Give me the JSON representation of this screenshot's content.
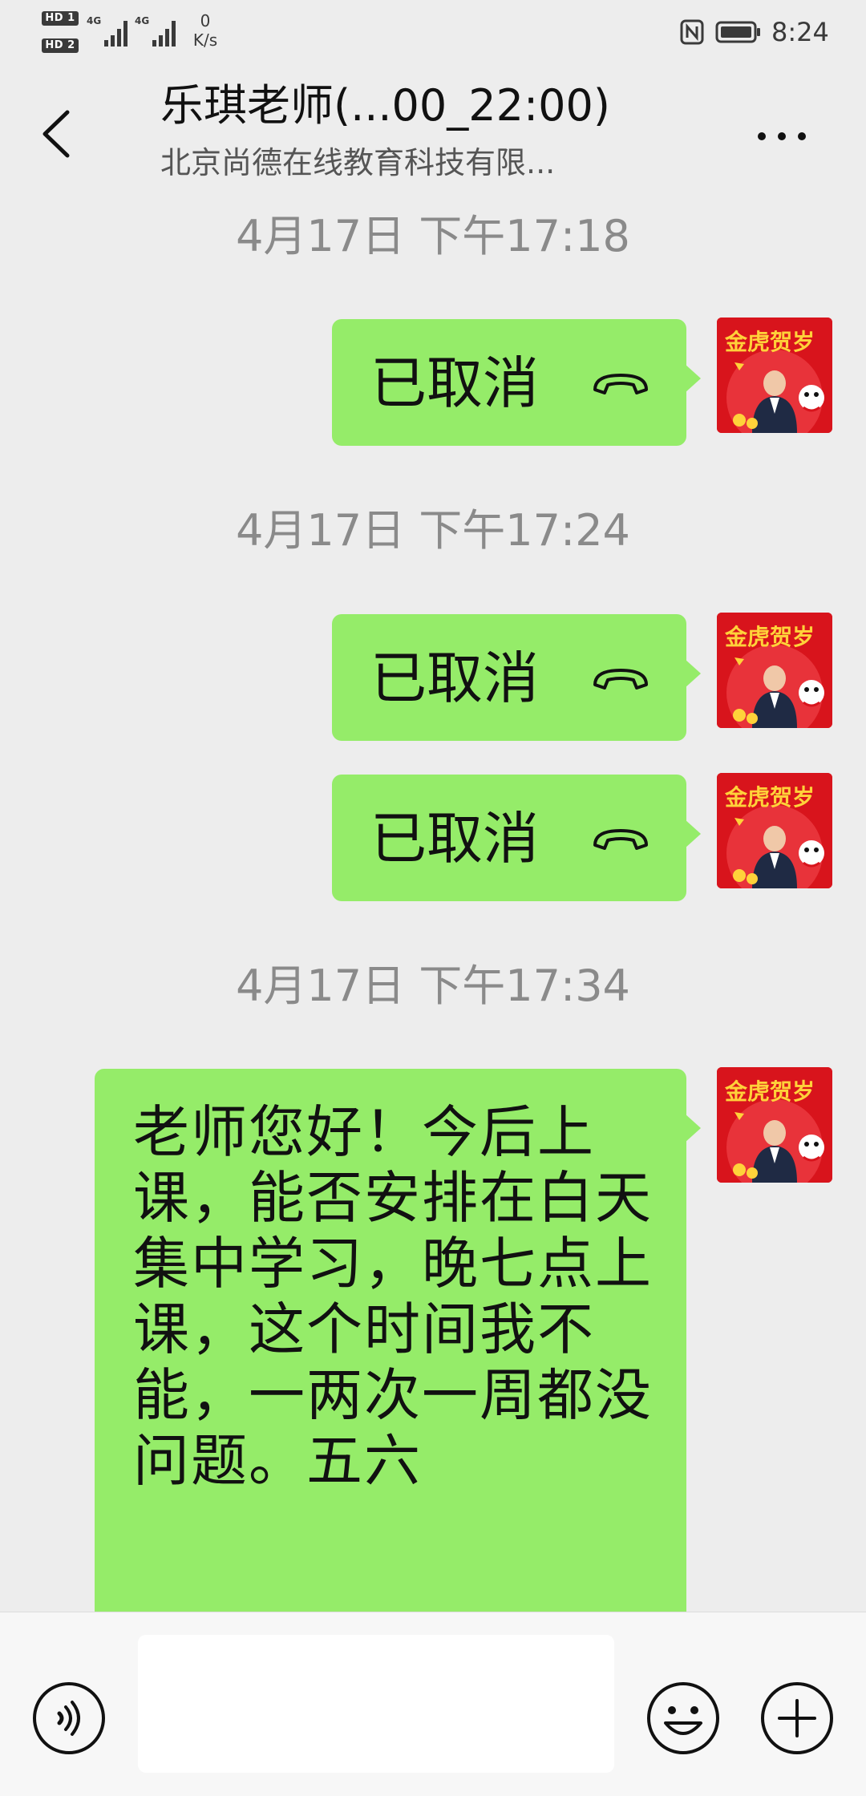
{
  "status_bar": {
    "hd_badge_1": "HD 1",
    "hd_badge_2": "HD 2",
    "network_1": "4G",
    "network_2": "4G",
    "net_speed_value": "0",
    "net_speed_unit": "K/s",
    "time": "8:24",
    "icons": [
      "hd-icon",
      "signal-icon",
      "nfc-icon",
      "battery-icon"
    ]
  },
  "header": {
    "title": "乐琪老师(...00_22:00)",
    "subtitle": "北京尚德在线教育科技有限...",
    "icons": [
      "back-arrow-icon",
      "more-dots-icon"
    ]
  },
  "chat": {
    "timestamps": [
      "4月17日 下午17:18",
      "4月17日 下午17:24",
      "4月17日 下午17:34"
    ],
    "messages": [
      {
        "type": "call",
        "text": "已取消",
        "icon": "phone-hangup-icon"
      },
      {
        "type": "call",
        "text": "已取消",
        "icon": "phone-hangup-icon"
      },
      {
        "type": "call",
        "text": "已取消",
        "icon": "phone-hangup-icon"
      },
      {
        "type": "text",
        "text": "老师您好！今后上课，能否安排在白天集中学习，晚七点上课，这个时间我不能，一两次一周都没问题。五六"
      }
    ],
    "avatar": {
      "text": "金虎贺岁",
      "colors": {
        "background": "#d8141c",
        "text": "#ffd23a"
      }
    }
  },
  "input_bar": {
    "value": "",
    "icons": [
      "voice-icon",
      "emoji-icon",
      "plus-icon"
    ]
  },
  "colors": {
    "background": "#ededed",
    "bubble_sent": "#95ec69",
    "timestamp": "#8a8a8a",
    "input_bar": "#f7f7f7"
  }
}
